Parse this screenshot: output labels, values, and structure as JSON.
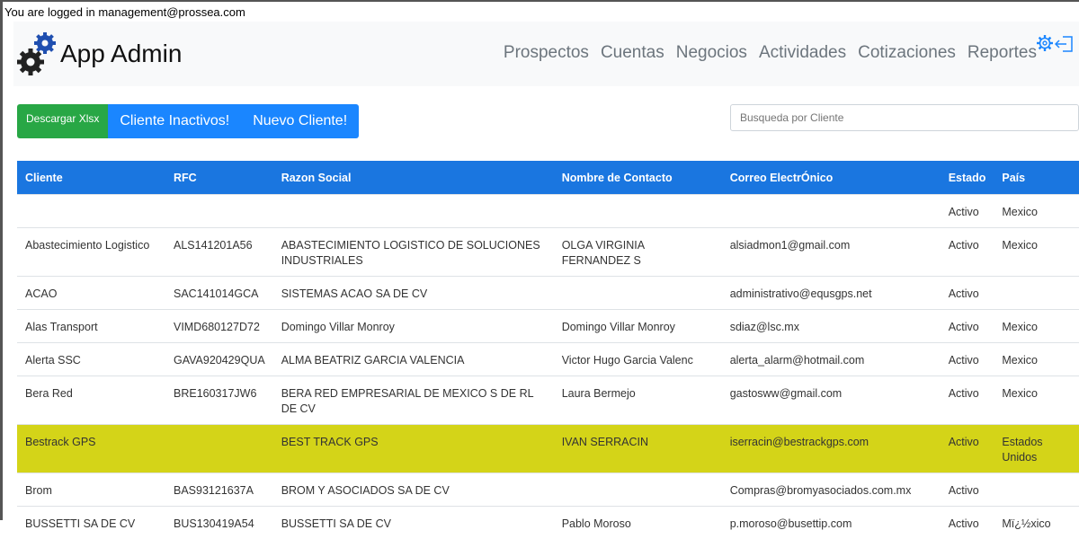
{
  "login_text": "You are logged in management@prossea.com",
  "brand": "App Admin",
  "nav": [
    "Prospectos",
    "Cuentas",
    "Negocios",
    "Actividades",
    "Cotizaciones",
    "Reportes"
  ],
  "icons": {
    "settings": "gear-icon",
    "logout": "logout-icon"
  },
  "buttons": {
    "download": "Descargar Xlsx",
    "inactive": "Cliente Inactivos!",
    "new": "Nuevo Cliente!"
  },
  "search": {
    "placeholder": "Busqueda por Cliente"
  },
  "table": {
    "headers": [
      "Cliente",
      "RFC",
      "Razon Social",
      "Nombre de Contacto",
      "Correo ElectrÓnico",
      "Estado",
      "País"
    ],
    "rows": [
      [
        "",
        "",
        "",
        "",
        "",
        "Activo",
        "Mexico"
      ],
      [
        "Abastecimiento Logistico",
        "ALS141201A56",
        "ABASTECIMIENTO LOGISTICO DE SOLUCIONES INDUSTRIALES",
        "OLGA VIRGINIA FERNANDEZ S",
        "alsiadmon1@gmail.com",
        "Activo",
        "Mexico"
      ],
      [
        "ACAO",
        "SAC141014GCA",
        "SISTEMAS ACAO SA DE CV",
        "",
        "administrativo@equsgps.net",
        "Activo",
        ""
      ],
      [
        "Alas Transport",
        "VIMD680127D72",
        "Domingo Villar Monroy",
        "Domingo Villar Monroy",
        "sdiaz@lsc.mx",
        "Activo",
        "Mexico"
      ],
      [
        "Alerta SSC",
        "GAVA920429QUA",
        "ALMA BEATRIZ GARCIA VALENCIA",
        "Victor Hugo Garcia Valenc",
        "alerta_alarm@hotmail.com",
        "Activo",
        "Mexico"
      ],
      [
        "Bera Red",
        "BRE160317JW6",
        "BERA RED EMPRESARIAL DE MEXICO S DE RL DE CV",
        "Laura Bermejo",
        "gastosww@gmail.com",
        "Activo",
        "Mexico"
      ],
      [
        "Bestrack GPS",
        "",
        "BEST TRACK GPS",
        "IVAN SERRACIN",
        "iserracin@bestrackgps.com",
        "Activo",
        "Estados Unidos"
      ],
      [
        "Brom",
        "BAS93121637A",
        "BROM Y ASOCIADOS SA DE CV",
        "",
        "Compras@bromyasociados.com.mx",
        "Activo",
        ""
      ],
      [
        "BUSSETTI SA DE CV",
        "BUS130419A54",
        "BUSSETTI SA DE CV",
        "Pablo Moroso",
        "p.moroso@busettip.com",
        "Activo",
        "Mï¿½xico"
      ]
    ],
    "highlight_color": "#d4d418",
    "highlight_row": 6
  },
  "colors": {
    "header": "#1a76e0",
    "green": "#28a745",
    "blue": "#1a86ff"
  }
}
